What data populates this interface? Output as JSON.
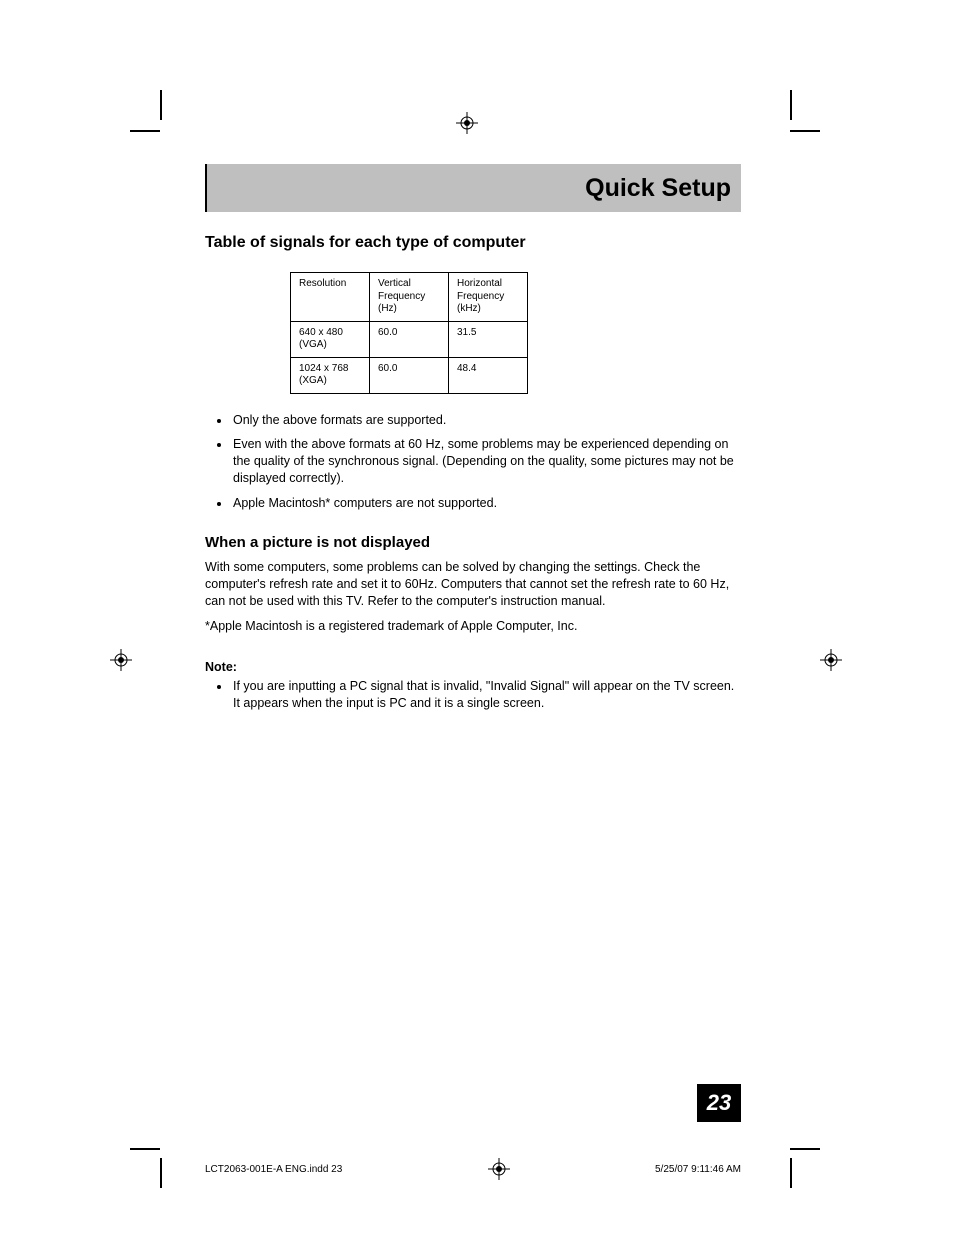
{
  "header": {
    "title": "Quick Setup"
  },
  "section1": {
    "title": "Table of signals for each type of computer",
    "table": {
      "headers": [
        "Resolution",
        "Vertical Frequency (Hz)",
        "Horizontal Frequency (kHz)"
      ],
      "rows": [
        {
          "c0": "640 x 480 (VGA)",
          "c1": "60.0",
          "c2": "31.5"
        },
        {
          "c0": "1024 x 768 (XGA)",
          "c1": "60.0",
          "c2": "48.4"
        }
      ]
    },
    "bullets": [
      "Only the above formats are supported.",
      "Even with the above formats at 60 Hz, some problems may be experienced depending on the quality of the synchronous signal.  (Depending on the quality, some pictures may not be displayed correctly).",
      "Apple Macintosh* computers are not supported."
    ]
  },
  "section2": {
    "title": "When a picture is not displayed",
    "para": "With some computers, some problems can be solved by changing the settings.  Check the computer's refresh rate and set it to 60Hz.  Computers that cannot set the refresh rate to 60 Hz, can not be used with this TV.  Refer to the computer's instruction manual.",
    "trademark": "*Apple Macintosh is a registered trademark of Apple Computer, Inc."
  },
  "note": {
    "label": "Note:",
    "bullets": [
      "If you are inputting a PC signal that is invalid, \"Invalid Signal\" will appear on the TV screen.  It appears when the input is PC and it is a single screen."
    ]
  },
  "page_number": "23",
  "footer": {
    "left": "LCT2063-001E-A ENG.indd   23",
    "right": "5/25/07   9:11:46 AM"
  }
}
